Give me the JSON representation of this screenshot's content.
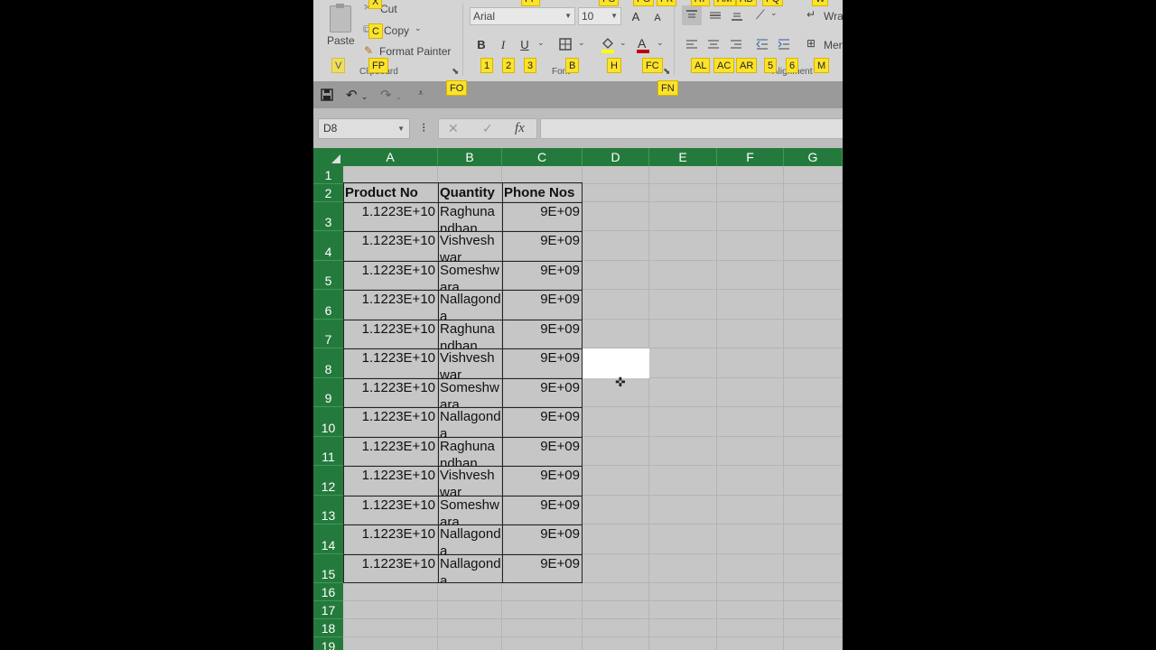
{
  "ribbon": {
    "clipboard": {
      "paste_label": "Paste",
      "cut_label": "Cut",
      "copy_label": "Copy",
      "format_painter_label": "Format Painter",
      "group_label": "Clipboard"
    },
    "font": {
      "font_name": "Arial",
      "font_size": "10",
      "bold": "B",
      "italic": "I",
      "underline": "U",
      "grow": "A",
      "shrink": "A",
      "group_label": "Font"
    },
    "alignment": {
      "wrap_label": "Wra",
      "merge_label": "Mer",
      "group_label": "Alignment"
    },
    "keytips": {
      "x": "X",
      "c": "C",
      "fp": "FP",
      "v": "V",
      "ff": "FF",
      "fs": "FS",
      "fg": "FG",
      "fk": "FK",
      "at": "AT",
      "am": "AM",
      "ab": "AB",
      "fq": "FQ",
      "w": "W",
      "k1": "1",
      "k2": "2",
      "k3": "3",
      "b": "B",
      "h": "H",
      "fc": "FC",
      "al": "AL",
      "ac": "AC",
      "ar": "AR",
      "k5": "5",
      "k6": "6",
      "m": "M",
      "fo": "FO",
      "fn": "FN"
    }
  },
  "qat": {
    "save": "save",
    "undo": "undo",
    "redo": "redo"
  },
  "formula_bar": {
    "name_box": "D8",
    "cancel": "✕",
    "enter": "✓",
    "fx": "fx",
    "formula": ""
  },
  "columns": [
    "A",
    "B",
    "C",
    "D",
    "E",
    "F",
    "G"
  ],
  "rows": [
    "1",
    "2",
    "3",
    "4",
    "5",
    "6",
    "7",
    "8",
    "9",
    "10",
    "11",
    "12",
    "13",
    "14",
    "15",
    "16",
    "17",
    "18",
    "19"
  ],
  "table": {
    "headers": [
      "Product No",
      "Quantity",
      "Phone Nos"
    ],
    "rows": [
      [
        "1.1223E+10",
        "Raghunandhan",
        "9E+09"
      ],
      [
        "1.1223E+10",
        "Vishveshwar",
        "9E+09"
      ],
      [
        "1.1223E+10",
        "Someshwara",
        "9E+09"
      ],
      [
        "1.1223E+10",
        "Nallagonda",
        "9E+09"
      ],
      [
        "1.1223E+10",
        "Raghunandhan",
        "9E+09"
      ],
      [
        "1.1223E+10",
        "Vishveshwar",
        "9E+09"
      ],
      [
        "1.1223E+10",
        "Someshwara",
        "9E+09"
      ],
      [
        "1.1223E+10",
        "Nallagonda",
        "9E+09"
      ],
      [
        "1.1223E+10",
        "Raghunandhan",
        "9E+09"
      ],
      [
        "1.1223E+10",
        "Vishveshwar",
        "9E+09"
      ],
      [
        "1.1223E+10",
        "Someshwara",
        "9E+09"
      ],
      [
        "1.1223E+10",
        "Nallagonda",
        "9E+09"
      ],
      [
        "1.1223E+10",
        "Nallagonda",
        "9E+09"
      ]
    ]
  },
  "active_cell": "D8",
  "colors": {
    "header_green": "#247a3c",
    "keytip_yellow": "#fbe22b",
    "font_color_red": "#c00000",
    "fill_yellow": "#ffff00"
  }
}
